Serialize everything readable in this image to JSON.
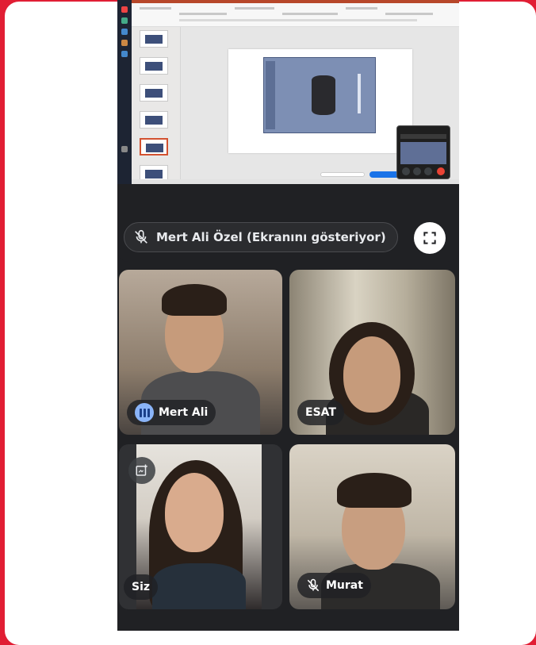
{
  "presentation": {
    "presenter_label": "Mert Ali Özel (Ekranını gösteriyor)"
  },
  "participants": [
    {
      "name": "Mert Ali",
      "speaking": true,
      "muted": false
    },
    {
      "name": "ESAT",
      "speaking": false,
      "muted": false
    },
    {
      "name": "Siz",
      "speaking": false,
      "muted": false
    },
    {
      "name": "Murat",
      "speaking": false,
      "muted": true
    }
  ],
  "icons": {
    "presenter_status": "mic-off-icon",
    "fullscreen": "fullscreen-icon",
    "speaking": "audio-level-icon",
    "self_tile_action": "picture-in-picture-icon",
    "murat_status": "mic-off-icon"
  },
  "colors": {
    "frame": "#e11e34",
    "meet_background": "#202124",
    "speaking_indicator": "#8ab4f8",
    "ppt_accent": "#d35230",
    "end_call": "#ea4335"
  }
}
